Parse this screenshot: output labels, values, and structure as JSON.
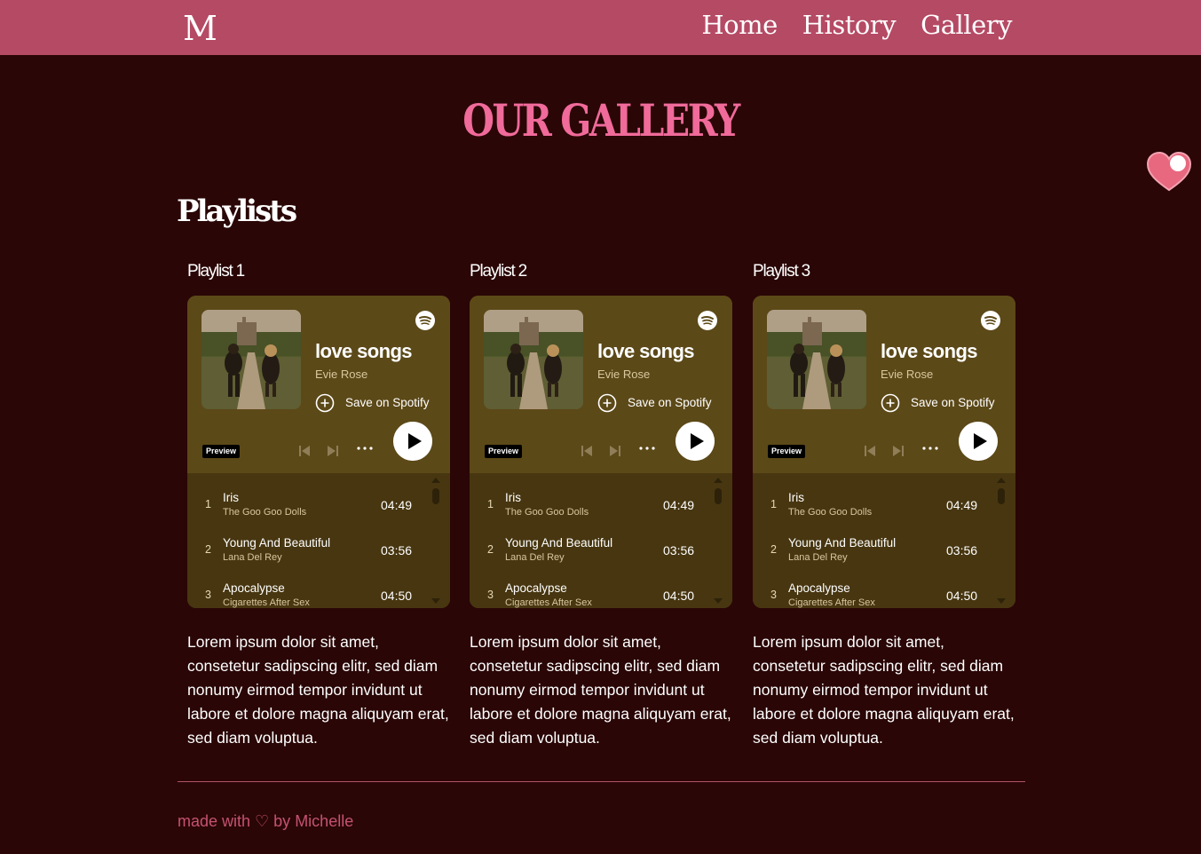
{
  "header": {
    "logo": "M",
    "nav": [
      "Home",
      "History",
      "Gallery"
    ]
  },
  "page_title": "OUR GALLERY",
  "section_title": "Playlists",
  "playlists": [
    {
      "label": "Playlist 1",
      "name": "love songs",
      "owner": "Evie Rose",
      "save_label": "Save on Spotify",
      "preview": "Preview",
      "tracks": [
        {
          "num": "1",
          "title": "Iris",
          "artist": "The Goo Goo Dolls",
          "duration": "04:49"
        },
        {
          "num": "2",
          "title": "Young And Beautiful",
          "artist": "Lana Del Rey",
          "duration": "03:56"
        },
        {
          "num": "3",
          "title": "Apocalypse",
          "artist": "Cigarettes After Sex",
          "duration": "04:50"
        }
      ],
      "description": "Lorem ipsum dolor sit amet, consetetur sadipscing elitr, sed diam nonumy eirmod tempor invidunt ut labore et dolore magna aliquyam erat, sed diam voluptua."
    },
    {
      "label": "Playlist 2",
      "name": "love songs",
      "owner": "Evie Rose",
      "save_label": "Save on Spotify",
      "preview": "Preview",
      "tracks": [
        {
          "num": "1",
          "title": "Iris",
          "artist": "The Goo Goo Dolls",
          "duration": "04:49"
        },
        {
          "num": "2",
          "title": "Young And Beautiful",
          "artist": "Lana Del Rey",
          "duration": "03:56"
        },
        {
          "num": "3",
          "title": "Apocalypse",
          "artist": "Cigarettes After Sex",
          "duration": "04:50"
        }
      ],
      "description": "Lorem ipsum dolor sit amet, consetetur sadipscing elitr, sed diam nonumy eirmod tempor invidunt ut labore et dolore magna aliquyam erat, sed diam voluptua."
    },
    {
      "label": "Playlist 3",
      "name": "love songs",
      "owner": "Evie Rose",
      "save_label": "Save on Spotify",
      "preview": "Preview",
      "tracks": [
        {
          "num": "1",
          "title": "Iris",
          "artist": "The Goo Goo Dolls",
          "duration": "04:49"
        },
        {
          "num": "2",
          "title": "Young And Beautiful",
          "artist": "Lana Del Rey",
          "duration": "03:56"
        },
        {
          "num": "3",
          "title": "Apocalypse",
          "artist": "Cigarettes After Sex",
          "duration": "04:50"
        }
      ],
      "description": "Lorem ipsum dolor sit amet, consetetur sadipscing elitr, sed diam nonumy eirmod tempor invidunt ut labore et dolore magna aliquyam erat, sed diam voluptua."
    }
  ],
  "footer": "made with ♡ by Michelle",
  "colors": {
    "topbar": "#b54a64",
    "background": "#2a0606",
    "title_pink": "#f06a9a",
    "card": "#5c4918",
    "tracklist": "#473610",
    "footer_text": "#c55272"
  },
  "icons": [
    "spotify-icon",
    "add-circle-icon",
    "previous-icon",
    "next-icon",
    "more-icon",
    "play-icon",
    "heart-icon"
  ]
}
